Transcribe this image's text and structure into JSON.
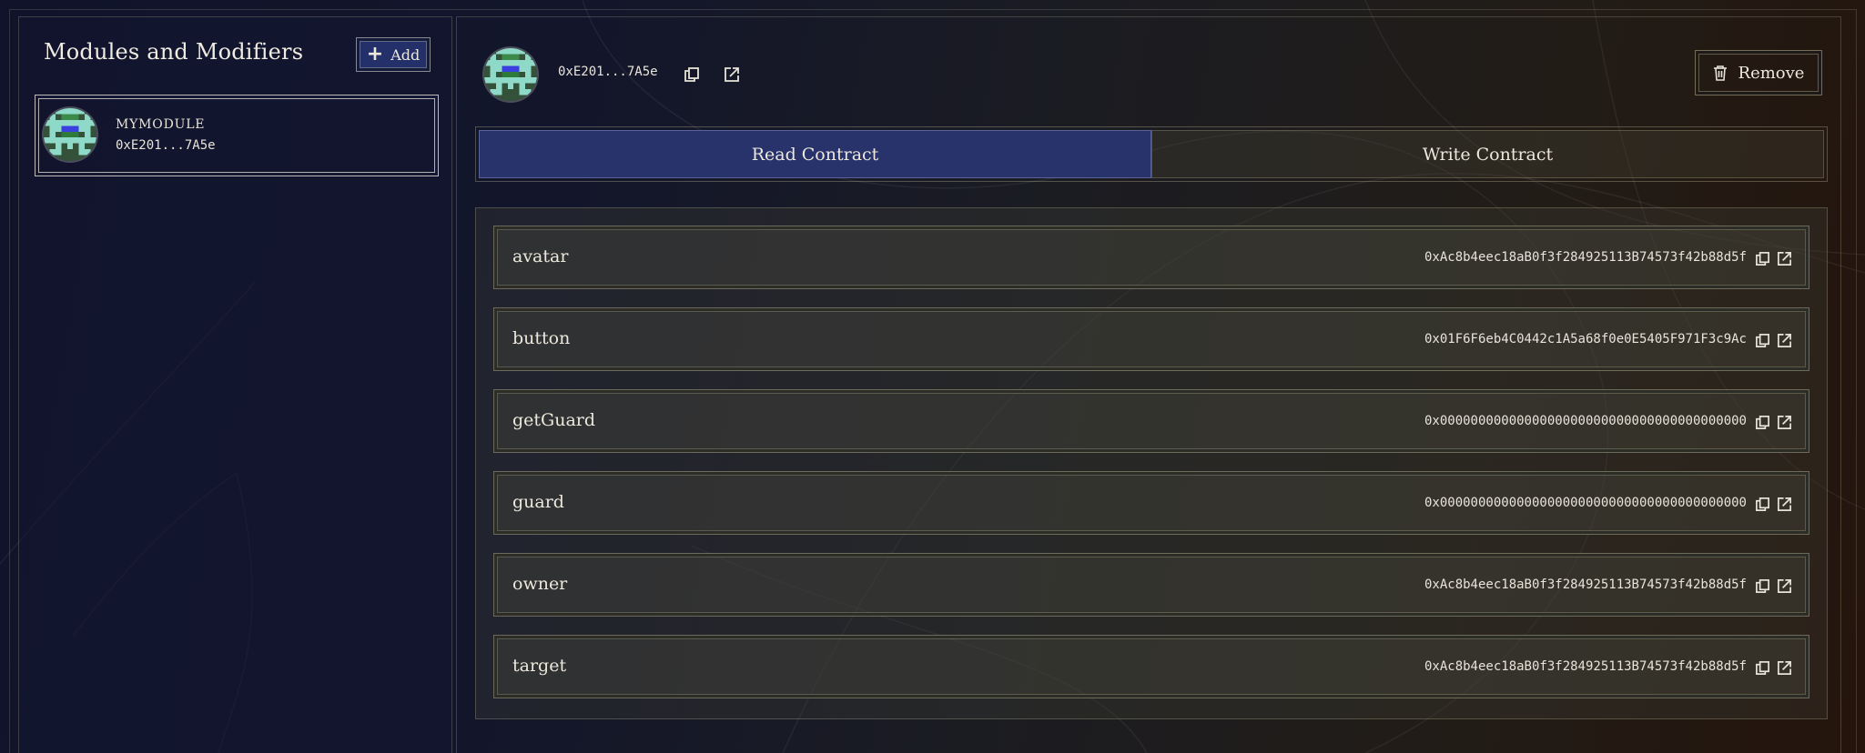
{
  "sidebar": {
    "title": "Modules and Modifiers",
    "add_label": "Add",
    "modules": [
      {
        "name": "MYMODULE",
        "address": "0xE201...7A5e"
      }
    ]
  },
  "header": {
    "address": "0xE201...7A5e",
    "remove_label": "Remove"
  },
  "tabs": [
    {
      "label": "Read Contract",
      "active": true
    },
    {
      "label": "Write Contract",
      "active": false
    }
  ],
  "fields": [
    {
      "name": "avatar",
      "value": "0xAc8b4eec18aB0f3f284925113B74573f42b88d5f"
    },
    {
      "name": "button",
      "value": "0x01F6F6eb4C0442c1A5a68f0e0E5405F971F3c9Ac"
    },
    {
      "name": "getGuard",
      "value": "0x0000000000000000000000000000000000000000"
    },
    {
      "name": "guard",
      "value": "0x0000000000000000000000000000000000000000"
    },
    {
      "name": "owner",
      "value": "0xAc8b4eec18aB0f3f284925113B74573f42b88d5f"
    },
    {
      "name": "target",
      "value": "0xAc8b4eec18aB0f3f284925113B74573f42b88d5f"
    }
  ],
  "colors": {
    "accent": "#29336b",
    "border": "#d9d4ad",
    "text": "#e8e4da"
  },
  "icons": {
    "add": "plus-icon",
    "copy": "copy-icon",
    "external_link": "external-link-icon",
    "remove": "trash-icon"
  }
}
